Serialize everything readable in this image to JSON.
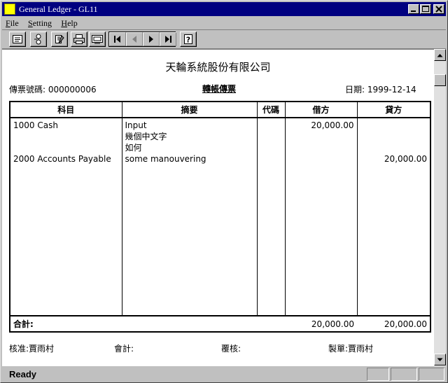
{
  "window": {
    "title": "General Ledger - GL11"
  },
  "menu": {
    "items": [
      {
        "label": "File",
        "key": "F",
        "rest": "ile"
      },
      {
        "label": "Setting",
        "key": "S",
        "rest": "etting"
      },
      {
        "label": "Help",
        "key": "H",
        "rest": "elp"
      }
    ]
  },
  "toolbar": {
    "icons": [
      "list-icon",
      "tree-icon",
      "edit-icon",
      "print-icon",
      "preview-icon"
    ],
    "nav": [
      "first-record-icon",
      "previous-record-icon",
      "next-record-icon",
      "last-record-icon"
    ],
    "help": "?"
  },
  "document": {
    "company": "天輪系統股份有限公司",
    "voucher_no_label": "傳票號碼:",
    "voucher_no": "000000006",
    "title": "轉帳傳票",
    "date_label": "日期:",
    "date": "1999-12-14",
    "columns": [
      "科目",
      "摘要",
      "代碼",
      "借方",
      "貸方"
    ],
    "entries": [
      {
        "account": "1000 Cash",
        "description": [
          "Input",
          "幾個中文字",
          "如何"
        ],
        "code": "",
        "debit": "20,000.00",
        "credit": ""
      },
      {
        "account": "2000 Accounts Payable",
        "description": [
          "some manouvering"
        ],
        "code": "",
        "debit": "",
        "credit": "20,000.00"
      }
    ],
    "total_label": "合計:",
    "total_debit": "20,000.00",
    "total_credit": "20,000.00",
    "signatures": {
      "approved_label": "核准:",
      "approved": "賈雨村",
      "accounting_label": "會計:",
      "accounting": "",
      "review_label": "覆核:",
      "review": "",
      "prepared_label": "製單:",
      "prepared": "賈雨村"
    }
  },
  "status": {
    "text": "Ready"
  }
}
